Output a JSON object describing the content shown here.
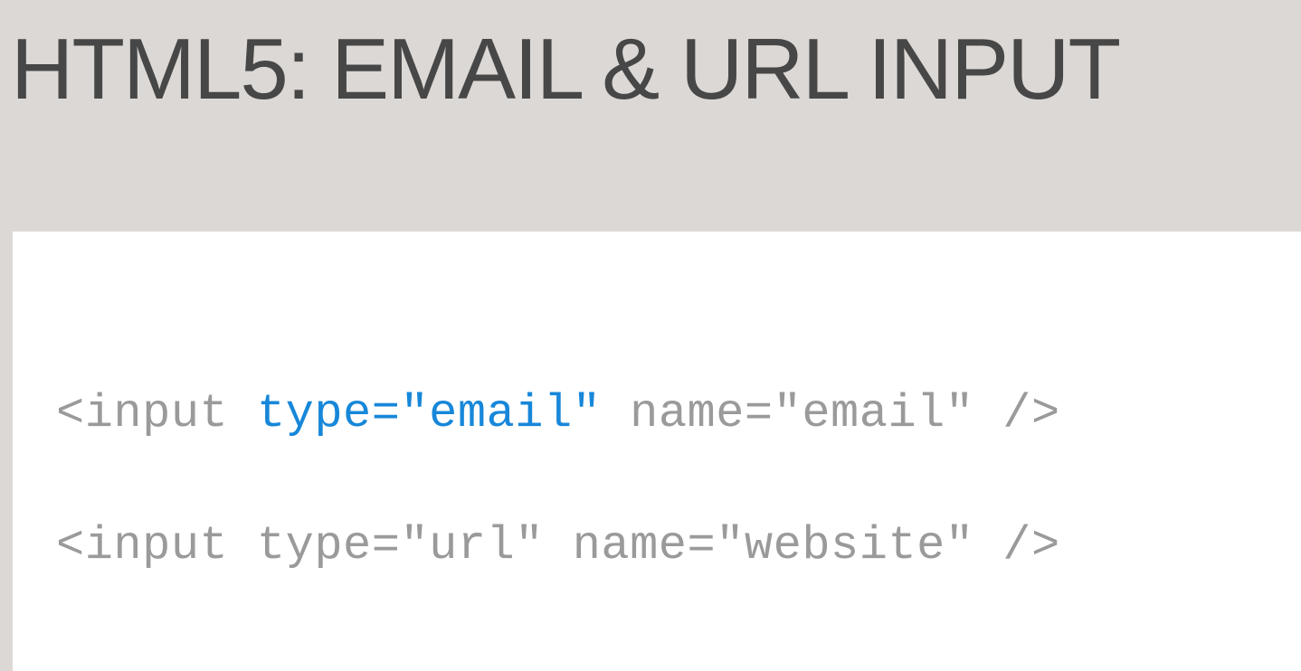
{
  "slide": {
    "title": "HTML5: EMAIL & URL INPUT",
    "code_lines": [
      {
        "segments": [
          {
            "text": "<input ",
            "highlight": false
          },
          {
            "text": "type=\"email\"",
            "highlight": true
          },
          {
            "text": " name=\"email\" />",
            "highlight": false
          }
        ]
      },
      {
        "segments": [
          {
            "text": "<input type=\"url\" name=\"website\" />",
            "highlight": false
          }
        ]
      }
    ]
  },
  "colors": {
    "background": "#dcd8d5",
    "panel": "#ffffff",
    "title_text": "#474747",
    "code_text": "#9a9a9a",
    "highlight": "#1787d9"
  }
}
